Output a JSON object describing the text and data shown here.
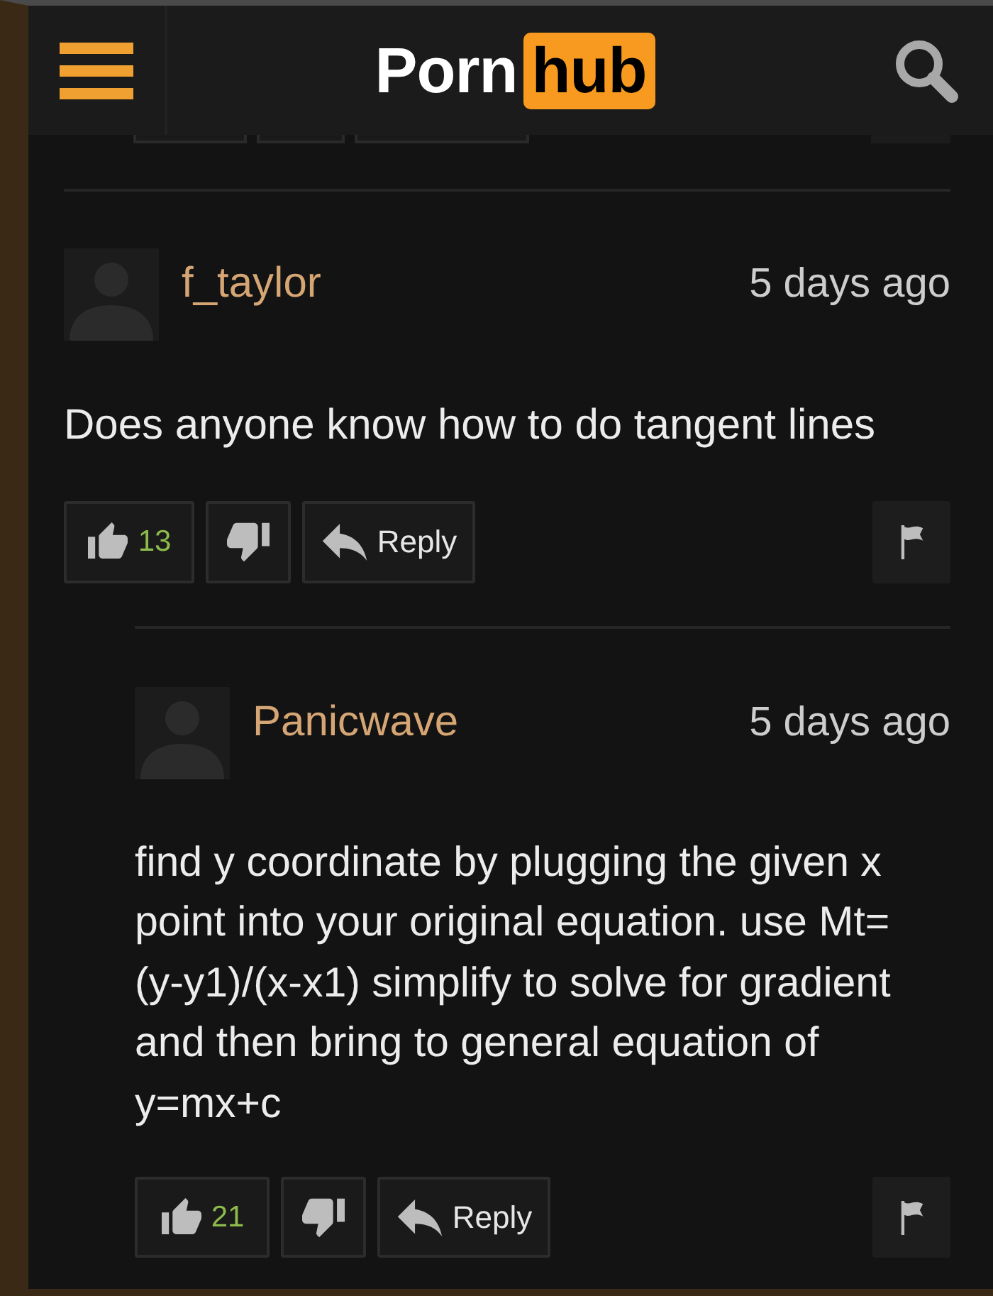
{
  "header": {
    "logo_text": "Porn",
    "logo_badge": "hub"
  },
  "comments": [
    {
      "username": "f_taylor",
      "time": "5 days ago",
      "body": "Does anyone know how to do tangent lines",
      "likes": "13",
      "reply_label": "Reply",
      "children": [
        {
          "username": "Panicwave",
          "time": "5 days ago",
          "body": "find y coordinate by plugging the given x point into your original equation. use Mt= (y-y1)/(x-x1) simplify to solve for gradient and then bring to general equation of y=mx+c",
          "likes": "21",
          "reply_label": "Reply"
        }
      ]
    }
  ]
}
